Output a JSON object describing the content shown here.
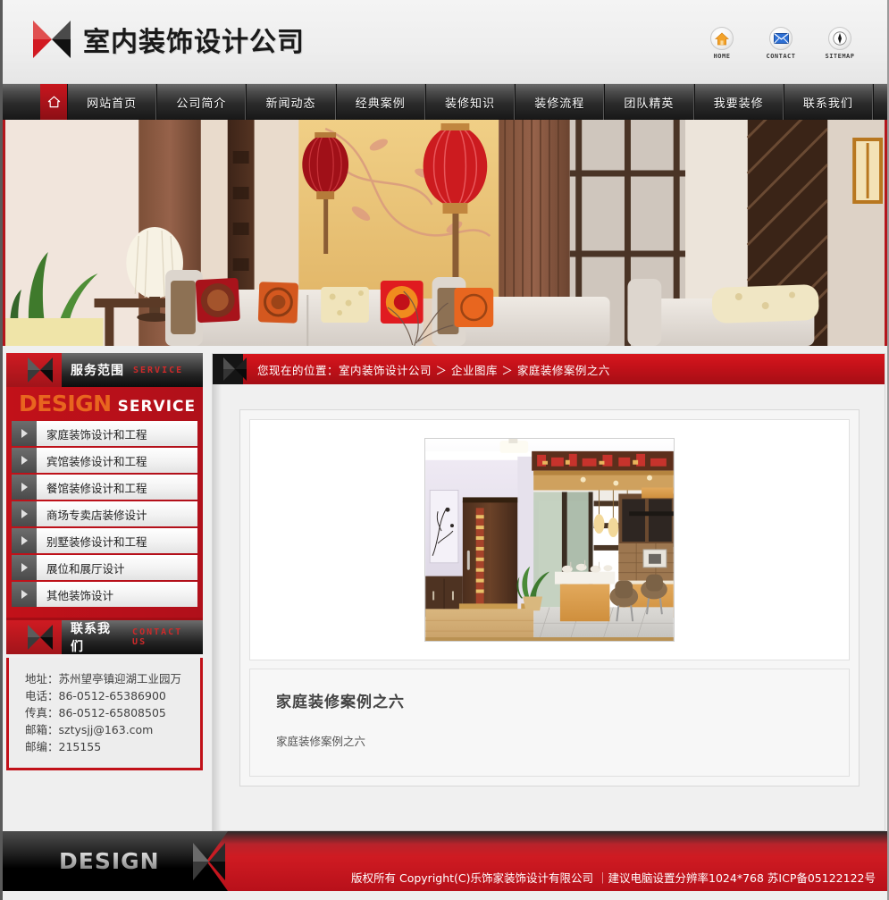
{
  "header": {
    "site_title": "室内装饰设计公司",
    "logo_icon": "diamond-logo-icon",
    "quick_icons": [
      {
        "label": "HOME",
        "icon": "house-icon"
      },
      {
        "label": "CONTACT",
        "icon": "envelope-icon"
      },
      {
        "label": "SITEMAP",
        "icon": "compass-icon"
      }
    ]
  },
  "nav": {
    "home_icon": "house-outline-icon",
    "items": [
      "网站首页",
      "公司简介",
      "新闻动态",
      "经典案例",
      "装修知识",
      "装修流程",
      "团队精英",
      "我要装修",
      "联系我们"
    ]
  },
  "banner": {
    "alt": "中式风格客厅室内装饰效果图，红色灯笼、木格栅隔断、布艺沙发与刺绣抱枕"
  },
  "sidebar": {
    "service_panel": {
      "title_cn": "服务范围",
      "title_en": "SERVICE",
      "banner_word": "DESIGN",
      "banner_sub": "SERVICE",
      "items": [
        "家庭装饰设计和工程",
        "宾馆装修设计和工程",
        "餐馆装修设计和工程",
        "商场专卖店装修设计",
        "别墅装修设计和工程",
        "展位和展厅设计",
        "其他装饰设计"
      ]
    },
    "contact_panel": {
      "title_cn": "联系我们",
      "title_en": "CONTACT US",
      "lines": [
        "地址：苏州望亭镇迎湖工业园万",
        "电话：86-0512-65386900",
        "传真：86-0512-65808505",
        "邮箱：sztysjj@163.com",
        "邮编：215155"
      ]
    }
  },
  "main": {
    "breadcrumb": "您现在的位置：室内装饰设计公司 ＞ 企业图库 ＞ 家庭装修案例之六",
    "image_alt": "家庭装修案例之六效果图：玄关木门、绿植、开放式餐厨与中式镂空吊顶",
    "article_title": "家庭装修案例之六",
    "article_body": "家庭装修案例之六"
  },
  "footer": {
    "brand_word": "DESIGN",
    "copyright": "版权所有  Copyright(C)乐饰家装饰设计有限公司  ｜建议电脑设置分辨率1024*768 苏ICP备05122122号"
  },
  "colors": {
    "brand_red": "#c21119",
    "dark_bar": "#232323",
    "accent_orange": "#e8651f",
    "page_bg": "#efefef"
  }
}
